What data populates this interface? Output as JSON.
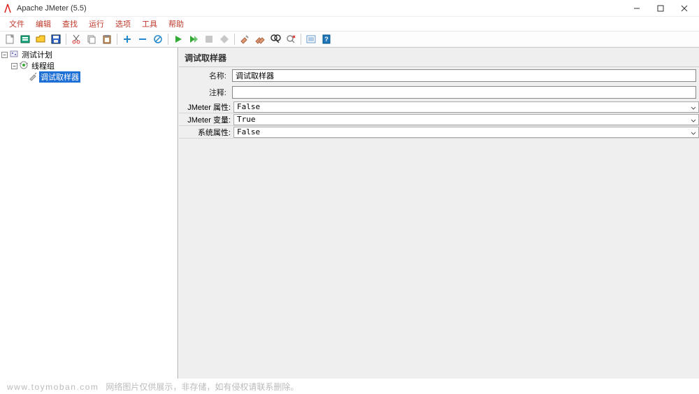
{
  "window": {
    "title": "Apache JMeter (5.5)"
  },
  "menu": {
    "items": [
      "文件",
      "编辑",
      "查找",
      "运行",
      "选项",
      "工具",
      "帮助"
    ]
  },
  "tree": {
    "root": {
      "label": "测试计划"
    },
    "group": {
      "label": "线程组"
    },
    "sampler": {
      "label": "调试取样器"
    }
  },
  "editor": {
    "title": "调试取样器",
    "name_label": "名称:",
    "name_value": "调试取样器",
    "comment_label": "注释:",
    "comment_value": "",
    "rows": [
      {
        "label": "JMeter 属性:",
        "value": "False"
      },
      {
        "label": "JMeter 变量:",
        "value": "True"
      },
      {
        "label": "系统属性:",
        "value": "False"
      }
    ]
  },
  "footer": {
    "domain": "www.toymoban.com",
    "note": "网络图片仅供展示，非存储，如有侵权请联系删除。"
  }
}
